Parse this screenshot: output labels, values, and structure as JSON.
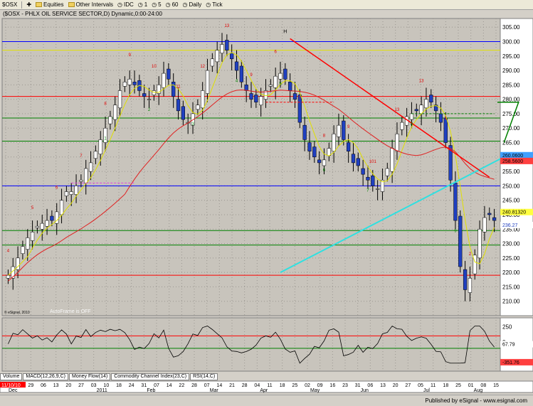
{
  "toolbar": {
    "symbol_field": "$OSX",
    "items": [
      "Equities",
      "Other Intervals",
      "IDC",
      "1",
      "5",
      "60",
      "Daily",
      "Tick"
    ]
  },
  "chart_title": "($OSX - PHLX OIL SERVICE SECTOR,D) Dynamic,0:00-24:00",
  "watermark": "© eSignal, 2010",
  "autoframe_note": "AutoFrame is OFF",
  "tabs": [
    "Volume",
    "MACD(12,26,9,C)",
    "Money Flow(14)",
    "Commodity Channel Index(23,C)",
    "RSI(14,C)"
  ],
  "footer": "Published by eSignal - www.esignal.com",
  "colors": {
    "background": "#d4d0c8",
    "up_candle": "#ffffff",
    "down_candle": "#2040c0",
    "red_line": "#ff0000",
    "blue_line": "#0000ff",
    "green_line": "#008000",
    "yellow_line": "#e0e000",
    "cyan_line": "#30e0e0",
    "ma_red": "#e02020"
  },
  "chart_data": {
    "type": "candlestick",
    "y_axis": {
      "min": 205,
      "max": 308,
      "ticks": [
        305,
        300,
        295,
        290,
        285,
        280,
        275,
        270,
        265,
        260,
        255,
        250,
        245,
        240,
        235,
        230,
        225,
        220,
        215,
        210
      ]
    },
    "x_axis": {
      "month_ticks": [
        "Dec",
        "2011",
        "Feb",
        "Mar",
        "Apr",
        "May",
        "Jun",
        "Jul",
        "Aug"
      ],
      "day_ticks": [
        "15",
        "22",
        "29",
        "06",
        "13",
        "20",
        "27",
        "03",
        "10",
        "18",
        "24",
        "31",
        "07",
        "14",
        "22",
        "28",
        "07",
        "14",
        "21",
        "28",
        "04",
        "11",
        "18",
        "25",
        "02",
        "09",
        "16",
        "23",
        "31",
        "06",
        "13",
        "20",
        "27",
        "05",
        "11",
        "18",
        "25",
        "01",
        "08",
        "15"
      ],
      "date_label": "11/10/10"
    },
    "close_path": [
      219,
      222,
      225,
      229,
      232,
      234,
      236,
      237,
      238,
      238,
      241,
      245,
      248,
      248,
      250,
      252,
      256,
      258,
      262,
      266,
      270,
      274,
      278,
      283,
      286,
      287,
      285,
      283,
      281,
      280,
      283,
      285,
      289,
      287,
      281,
      276,
      273,
      272,
      275,
      278,
      283,
      290,
      294,
      297,
      299,
      297,
      294,
      290,
      286,
      283,
      280,
      279,
      281,
      283,
      285,
      288,
      289,
      287,
      283,
      280,
      272,
      266,
      262,
      260,
      258,
      259,
      263,
      268,
      271,
      266,
      262,
      258,
      257,
      254,
      252,
      250,
      249,
      252,
      256,
      263,
      268,
      272,
      274,
      275,
      276,
      278,
      280,
      279,
      276,
      272,
      265,
      252,
      238,
      222,
      214,
      218,
      226,
      235,
      239,
      240,
      238
    ],
    "price_labels": {
      "red": "258.5600",
      "green": "260.0600",
      "yellow": "240.81320",
      "blue": "236.27"
    },
    "horizontal_levels": [
      {
        "value": 300,
        "color": "blue"
      },
      {
        "value": 297,
        "color": "yellow"
      },
      {
        "value": 281,
        "color": "red"
      },
      {
        "value": 273.5,
        "color": "green"
      },
      {
        "value": 265.5,
        "color": "green"
      },
      {
        "value": 250,
        "color": "blue"
      },
      {
        "value": 234.5,
        "color": "green"
      },
      {
        "value": 229.5,
        "color": "green"
      },
      {
        "value": 219,
        "color": "red"
      }
    ],
    "count_labels_red": [
      "4",
      "5",
      "6",
      "7",
      "8",
      "9",
      "10",
      "11",
      "12",
      "13",
      "9",
      "6",
      "7",
      "8",
      "9",
      "101",
      "13",
      "13",
      "1",
      "2"
    ],
    "count_labels_green": [
      "1",
      "2",
      "3",
      "4",
      "5",
      "6",
      "7",
      "8",
      "9"
    ],
    "indicator": {
      "name": "RSI(14,C)",
      "ticks": [
        250,
        0
      ],
      "right_labels": [
        "67.79",
        "-351.76"
      ],
      "levels": [
        100,
        -100
      ]
    }
  }
}
